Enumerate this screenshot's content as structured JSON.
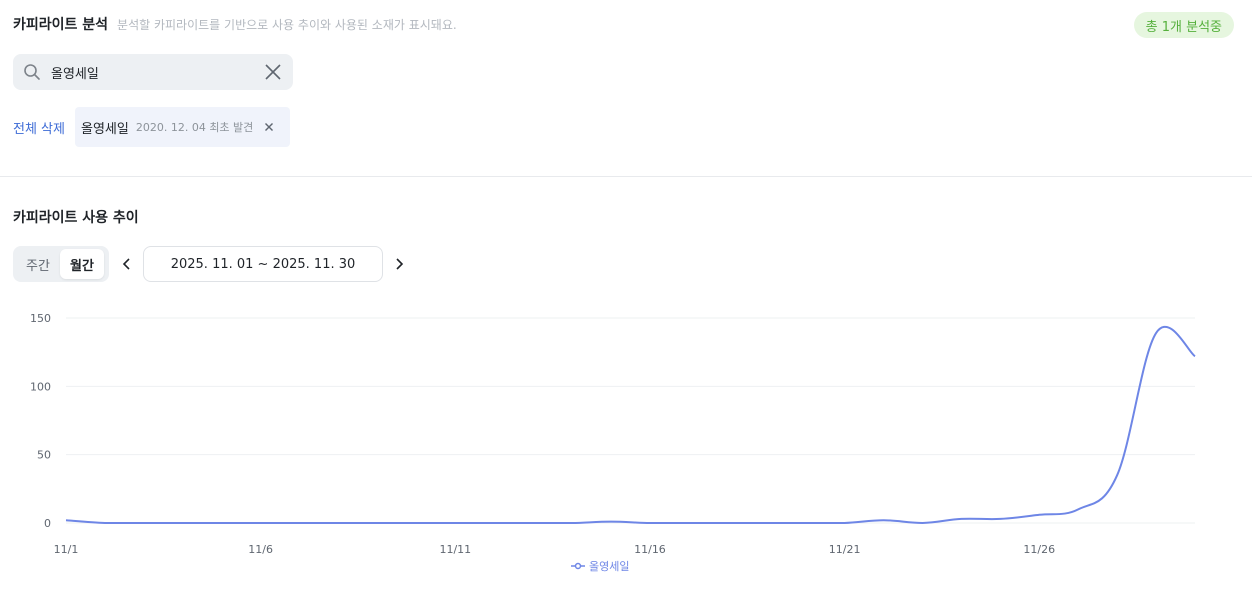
{
  "header": {
    "title": "카피라이트 분석",
    "subtitle": "분석할 카피라이트를 기반으로 사용 추이와 사용된 소재가 표시돼요.",
    "badge": "총 1개 분석중"
  },
  "search": {
    "value": "올영세일",
    "icons": [
      "search-icon",
      "close-icon"
    ]
  },
  "filters": {
    "delete_all_label": "전체 삭제",
    "chips": [
      {
        "name": "올영세일",
        "meta": "2020. 12. 04 최초 발견"
      }
    ]
  },
  "trend": {
    "title": "카피라이트 사용 추이",
    "period_options": [
      "주간",
      "월간"
    ],
    "active_period": "월간",
    "date_range": "2025. 11. 01 ~ 2025. 11. 30"
  },
  "colors": {
    "accent": "#3d6bd6",
    "series": "#6e86e6",
    "badge_bg": "#e6f6df",
    "badge_text": "#55b03c"
  },
  "chart_data": {
    "type": "line",
    "x": [
      "11/1",
      "11/2",
      "11/3",
      "11/4",
      "11/5",
      "11/6",
      "11/7",
      "11/8",
      "11/9",
      "11/10",
      "11/11",
      "11/12",
      "11/13",
      "11/14",
      "11/15",
      "11/16",
      "11/17",
      "11/18",
      "11/19",
      "11/20",
      "11/21",
      "11/22",
      "11/23",
      "11/24",
      "11/25",
      "11/26",
      "11/27",
      "11/28",
      "11/29",
      "11/30"
    ],
    "x_tick_labels": [
      "11/1",
      "11/6",
      "11/11",
      "11/16",
      "11/21",
      "11/26"
    ],
    "y_ticks": [
      0,
      50,
      100,
      150
    ],
    "ylim": [
      0,
      150
    ],
    "series": [
      {
        "name": "올영세일",
        "values": [
          2,
          0,
          0,
          0,
          0,
          0,
          0,
          0,
          0,
          0,
          0,
          0,
          0,
          0,
          1,
          0,
          0,
          0,
          0,
          0,
          0,
          2,
          0,
          3,
          3,
          6,
          10,
          35,
          139,
          122
        ]
      }
    ],
    "grid": true,
    "legend": "bottom-center"
  }
}
